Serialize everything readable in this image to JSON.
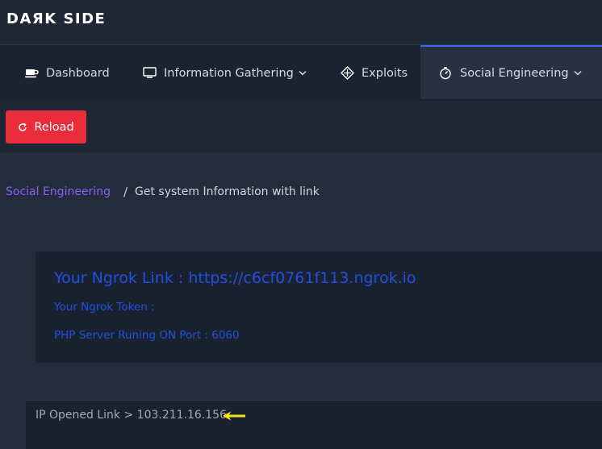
{
  "header": {
    "logo": "DAЯK SIDE"
  },
  "nav": {
    "items": [
      {
        "label": "Dashboard",
        "icon": "coffee-cup-icon"
      },
      {
        "label": "Information Gathering",
        "icon": "monitor-icon",
        "dropdown": true
      },
      {
        "label": "Exploits",
        "icon": "crosshair-icon"
      },
      {
        "label": "Social Engineering",
        "icon": "stopwatch-icon",
        "dropdown": true,
        "active": true
      }
    ]
  },
  "toolbar": {
    "reload_label": "Reload",
    "reload_icon": "refresh-icon"
  },
  "breadcrumb": {
    "parent": "Social Engineering",
    "separator": "/",
    "current": "Get system Information with link"
  },
  "card": {
    "title": "Your Ngrok Link : https://c6cf0761f113.ngrok.io",
    "token_line": "Your Ngrok Token :",
    "server_line": "PHP Server Runing ON Port : 6060"
  },
  "output": {
    "text": "IP Opened Link > 103.211.16.156",
    "annotation_icon": "arrow-left-icon"
  },
  "colors": {
    "accent": "#3f6af0",
    "reload_bg": "#ea2d3b",
    "link_blue": "#1f4fe0",
    "breadcrumb_purple": "#8b5cf6",
    "arrow_yellow": "#f5e31a"
  }
}
